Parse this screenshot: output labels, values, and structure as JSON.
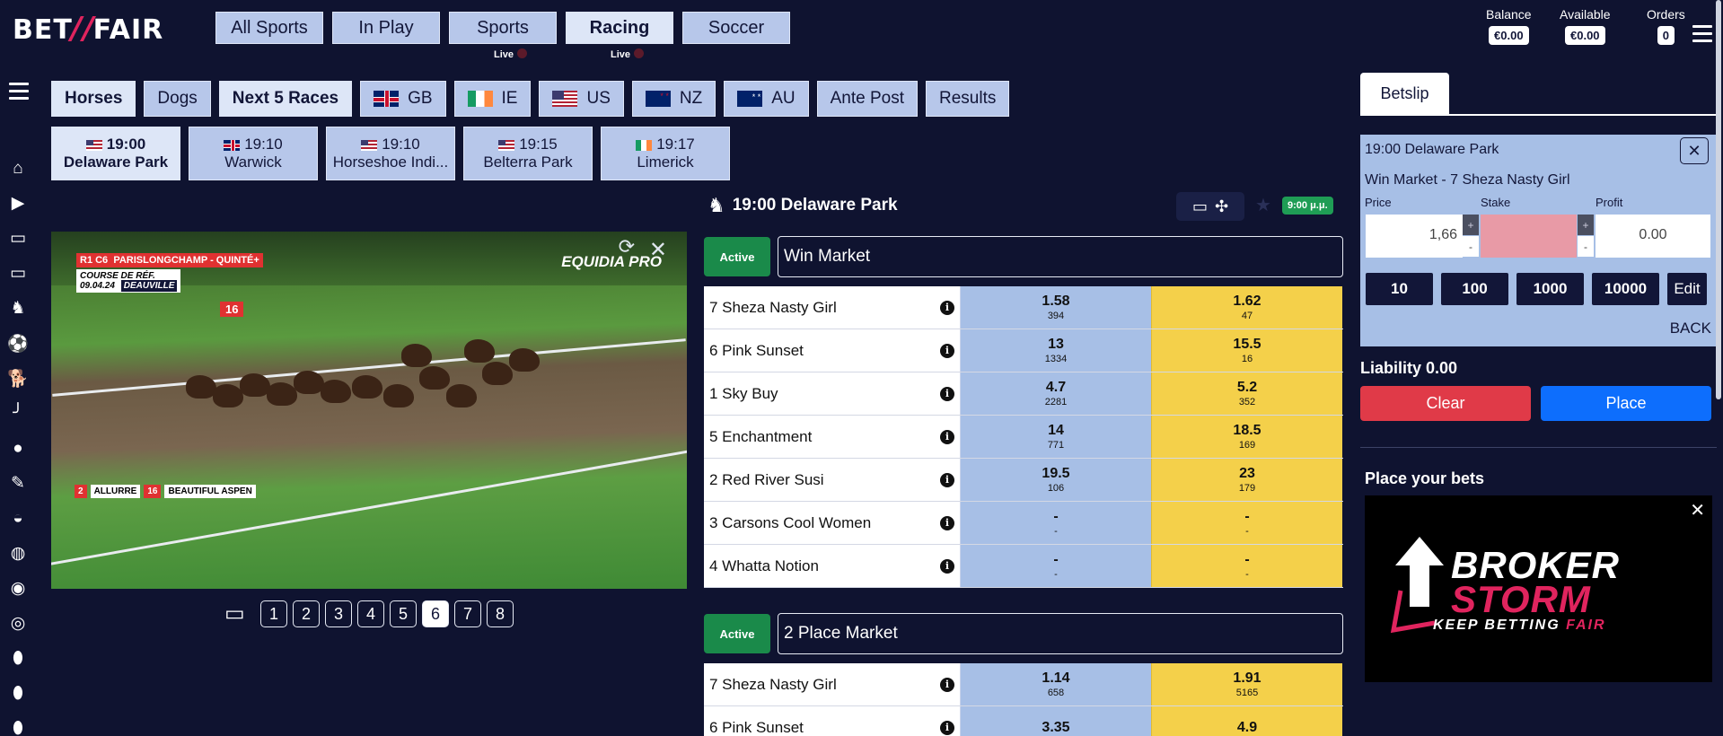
{
  "brand": {
    "part1": "BET",
    "part2": "FAIR"
  },
  "topnav": [
    {
      "label": "All Sports",
      "active": false,
      "live": ""
    },
    {
      "label": "In Play",
      "active": false,
      "live": ""
    },
    {
      "label": "Sports",
      "active": false,
      "live": "Live"
    },
    {
      "label": "Racing",
      "active": true,
      "live": "Live"
    },
    {
      "label": "Soccer",
      "active": false,
      "live": ""
    }
  ],
  "account": {
    "balance_label": "Balance",
    "balance": "€0.00",
    "available_label": "Available",
    "available": "€0.00",
    "orders_label": "Orders",
    "orders": "0"
  },
  "subnav": [
    {
      "label": "Horses",
      "flag": "",
      "active": true
    },
    {
      "label": "Dogs",
      "flag": "",
      "active": false
    },
    {
      "label": "Next 5 Races",
      "flag": "",
      "active": true
    },
    {
      "label": "GB",
      "flag": "gb",
      "active": false
    },
    {
      "label": "IE",
      "flag": "ie",
      "active": false
    },
    {
      "label": "US",
      "flag": "us",
      "active": false
    },
    {
      "label": "NZ",
      "flag": "nz",
      "active": false
    },
    {
      "label": "AU",
      "flag": "au",
      "active": false
    },
    {
      "label": "Ante Post",
      "flag": "",
      "active": false
    },
    {
      "label": "Results",
      "flag": "",
      "active": false
    }
  ],
  "races": [
    {
      "time": "19:00",
      "name": "Delaware Park",
      "flag": "us",
      "active": true
    },
    {
      "time": "19:10",
      "name": "Warwick",
      "flag": "gb",
      "active": false
    },
    {
      "time": "19:10",
      "name": "Horseshoe Indi...",
      "flag": "us",
      "active": false
    },
    {
      "time": "19:15",
      "name": "Belterra Park",
      "flag": "us",
      "active": false
    },
    {
      "time": "19:17",
      "name": "Limerick",
      "flag": "ie",
      "active": false
    }
  ],
  "video": {
    "overlay_race": "R1 C6",
    "overlay_track": "PARISLONGCHAMP - QUINTÉ+",
    "overlay_course": "COURSE DE RÉF.",
    "overlay_date": "09.04.24",
    "overlay_venue": "DEAUVILLE",
    "position_no": "16",
    "runner1_no": "2",
    "runner1_name": "ALLURRE",
    "runner2_no": "16",
    "runner2_name": "BEAUTIFUL ASPEN",
    "channel_logo": "EQUIDIA PRO",
    "pages": [
      "1",
      "2",
      "3",
      "4",
      "5",
      "6",
      "7",
      "8"
    ],
    "active_page": "6"
  },
  "race_header": {
    "title": "19:00 Delaware Park",
    "time_badge": "9:00 μ.μ."
  },
  "markets": [
    {
      "status": "Active",
      "name": "Win Market",
      "runners": [
        {
          "name": "7 Sheza Nasty Girl",
          "back": "1.58",
          "back_vol": "394",
          "lay": "1.62",
          "lay_vol": "47"
        },
        {
          "name": "6 Pink Sunset",
          "back": "13",
          "back_vol": "1334",
          "lay": "15.5",
          "lay_vol": "16"
        },
        {
          "name": "1 Sky Buy",
          "back": "4.7",
          "back_vol": "2281",
          "lay": "5.2",
          "lay_vol": "352"
        },
        {
          "name": "5 Enchantment",
          "back": "14",
          "back_vol": "771",
          "lay": "18.5",
          "lay_vol": "169"
        },
        {
          "name": "2 Red River Susi",
          "back": "19.5",
          "back_vol": "106",
          "lay": "23",
          "lay_vol": "179"
        },
        {
          "name": "3 Carsons Cool Women",
          "back": "-",
          "back_vol": "-",
          "lay": "-",
          "lay_vol": "-"
        },
        {
          "name": "4 Whatta Notion",
          "back": "-",
          "back_vol": "-",
          "lay": "-",
          "lay_vol": "-"
        }
      ]
    },
    {
      "status": "Active",
      "name": "2 Place Market",
      "runners": [
        {
          "name": "7 Sheza Nasty Girl",
          "back": "1.14",
          "back_vol": "658",
          "lay": "1.91",
          "lay_vol": "5165"
        },
        {
          "name": "6 Pink Sunset",
          "back": "3.35",
          "back_vol": "",
          "lay": "4.9",
          "lay_vol": ""
        }
      ]
    }
  ],
  "betslip": {
    "tab": "Betslip",
    "race": "19:00 Delaware Park",
    "selection": "Win Market - 7 Sheza Nasty Girl",
    "price_label": "Price",
    "stake_label": "Stake",
    "profit_label": "Profit",
    "price": "1,66",
    "stake": "",
    "profit": "0.00",
    "quick_stakes": [
      "10",
      "100",
      "1000",
      "10000"
    ],
    "edit_label": "Edit",
    "side": "BACK",
    "liability": "Liability 0.00",
    "clear_label": "Clear",
    "place_label": "Place",
    "promo_title": "Place your bets",
    "ad_line1": "BROKER",
    "ad_line2": "STORM",
    "ad_tag1": "KEEP BETTING",
    "ad_tag2": "FAIR"
  },
  "colors": {
    "background": "#0f1330",
    "back": "#a7bfe6",
    "lay": "#f4d04a",
    "active": "#1a8a4a",
    "clear": "#e03a48",
    "place": "#0d6efd"
  }
}
